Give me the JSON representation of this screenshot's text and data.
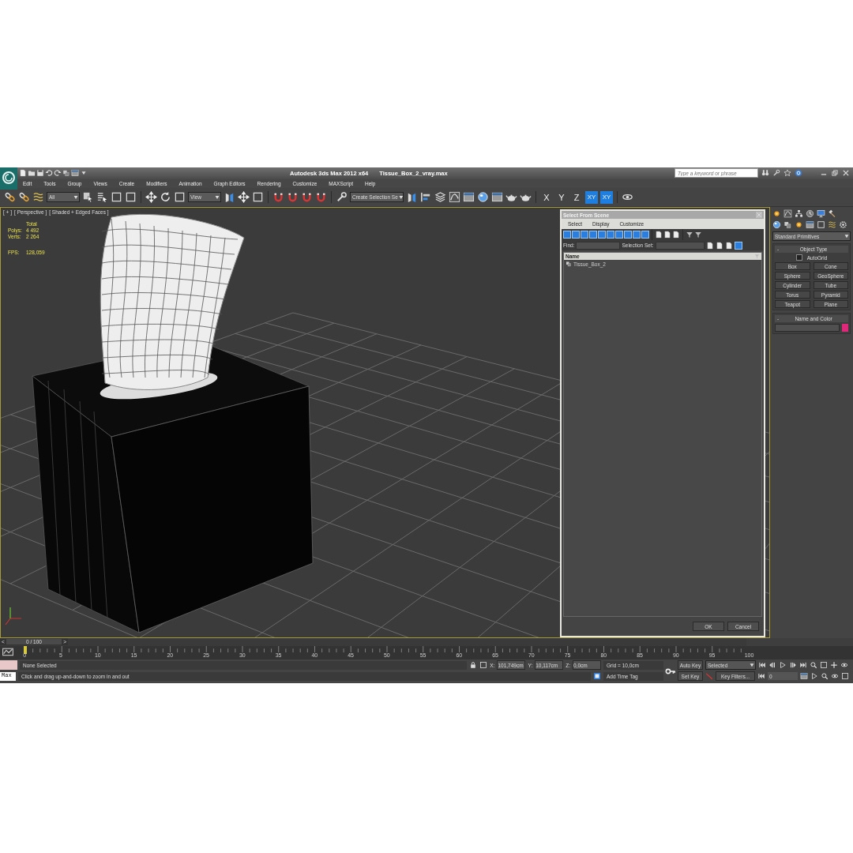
{
  "title_bar": {
    "app_title": "Autodesk 3ds Max  2012 x64",
    "file_name": "Tissue_Box_2_vray.max",
    "search": {
      "placeholder": "Type a keyword or phrase"
    }
  },
  "menu": [
    "Edit",
    "Tools",
    "Group",
    "Views",
    "Create",
    "Modifiers",
    "Animation",
    "Graph Editors",
    "Rendering",
    "Customize",
    "MAXScript",
    "Help"
  ],
  "main_toolbar": {
    "selection_filter": "All",
    "reference_coord": "View",
    "named_selection": "Create Selection Se",
    "axes": [
      {
        "label": "X",
        "selected": false
      },
      {
        "label": "Y",
        "selected": false
      },
      {
        "label": "Z",
        "selected": false
      },
      {
        "label": "XY",
        "selected": true
      },
      {
        "label": "XY",
        "selected": true
      }
    ]
  },
  "viewport": {
    "labels": [
      "[ + ]",
      "[ Perspective ]",
      "[ Shaded + Edged Faces ]"
    ],
    "stats_header": "Total",
    "stats": [
      {
        "label": "Polys:",
        "value": "4 492"
      },
      {
        "label": "Verts:",
        "value": "2 264"
      },
      {
        "label": "FPS:",
        "value": "128,059"
      }
    ]
  },
  "dialog": {
    "title": "Select From Scene",
    "menu": [
      "Select",
      "Display",
      "Customize"
    ],
    "find_label": "Find:",
    "selection_set_label": "Selection Set:",
    "column": "Name",
    "items": [
      {
        "name": "Tissue_Box_2",
        "selected": false
      }
    ],
    "buttons": [
      "OK",
      "Cancel"
    ]
  },
  "command_panel": {
    "category": "Standard Primitives",
    "object_type": {
      "toggle": "-",
      "title": "Object Type",
      "autogrid": {
        "label": "AutoGrid",
        "checked": false
      },
      "buttons": [
        "Box",
        "Cone",
        "Sphere",
        "GeoSphere",
        "Cylinder",
        "Tube",
        "Torus",
        "Pyramid",
        "Teapot",
        "Plane"
      ]
    },
    "name_and_color": {
      "toggle": "-",
      "title": "Name and Color",
      "color": "#e0287a"
    }
  },
  "time_slider": {
    "prev": "<",
    "frame": "0 / 100",
    "next": ">"
  },
  "track_bar": {
    "tick_labels": [
      "0",
      "5",
      "10",
      "15",
      "20",
      "25",
      "30",
      "35",
      "40",
      "45",
      "50",
      "55",
      "60",
      "65",
      "70",
      "75",
      "80",
      "85",
      "90",
      "95",
      "100"
    ]
  },
  "status": {
    "listener": "Max",
    "selection": "None Selected",
    "prompt": "Click and drag up-and-down to zoom in and out",
    "x_label": "X:",
    "x": "101,749cm",
    "y_label": "Y:",
    "y": "10,117cm",
    "z_label": "Z:",
    "z": "0,0cm",
    "grid": "Grid = 10,0cm",
    "add_time_tag": "Add Time Tag",
    "auto_key": "Auto Key",
    "key_mode": "Selected",
    "set_key": "Set Key",
    "key_filters": "Key Filters...",
    "frame": "0"
  }
}
